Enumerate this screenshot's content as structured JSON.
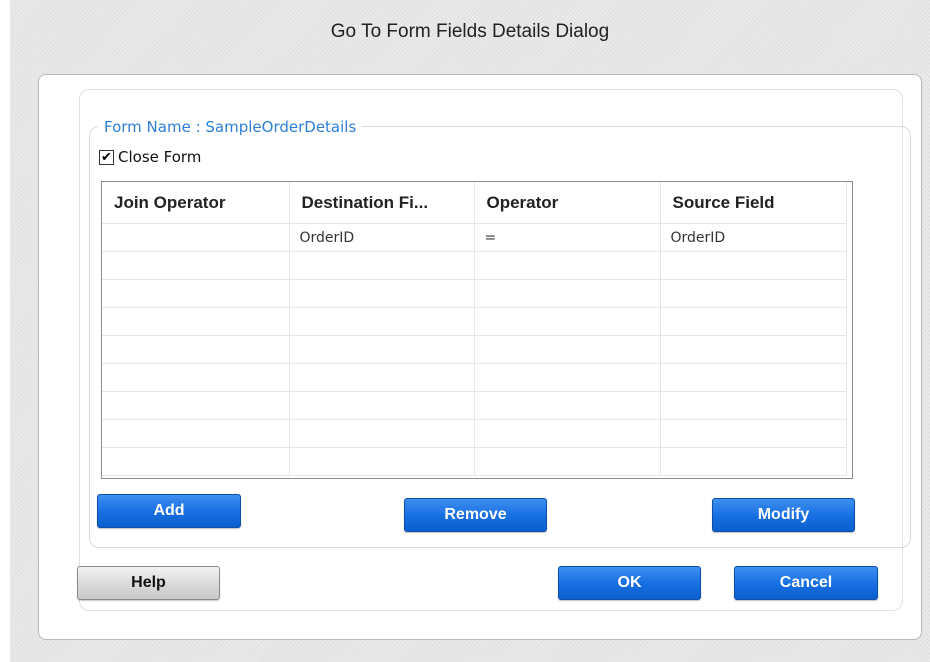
{
  "dialog": {
    "title": "Go To Form Fields Details Dialog"
  },
  "form": {
    "legend": "Form Name : SampleOrderDetails",
    "close_form_label": "Close Form",
    "close_form_checked": true
  },
  "grid": {
    "columns": [
      "Join Operator",
      "Destination Fi...",
      "Operator",
      "Source Field"
    ],
    "rows": [
      [
        "",
        "OrderID",
        "=",
        "OrderID"
      ],
      [
        "",
        "",
        "",
        ""
      ],
      [
        "",
        "",
        "",
        ""
      ],
      [
        "",
        "",
        "",
        ""
      ],
      [
        "",
        "",
        "",
        ""
      ],
      [
        "",
        "",
        "",
        ""
      ],
      [
        "",
        "",
        "",
        ""
      ],
      [
        "",
        "",
        "",
        ""
      ],
      [
        "",
        "",
        "",
        ""
      ]
    ]
  },
  "buttons": {
    "add": "Add",
    "remove": "Remove",
    "modify": "Modify",
    "help": "Help",
    "ok": "OK",
    "cancel": "Cancel"
  },
  "colors": {
    "accent_blue": "#1870e3",
    "legend_blue": "#2e7fd6",
    "dialog_bg": "#e7e7e7"
  }
}
